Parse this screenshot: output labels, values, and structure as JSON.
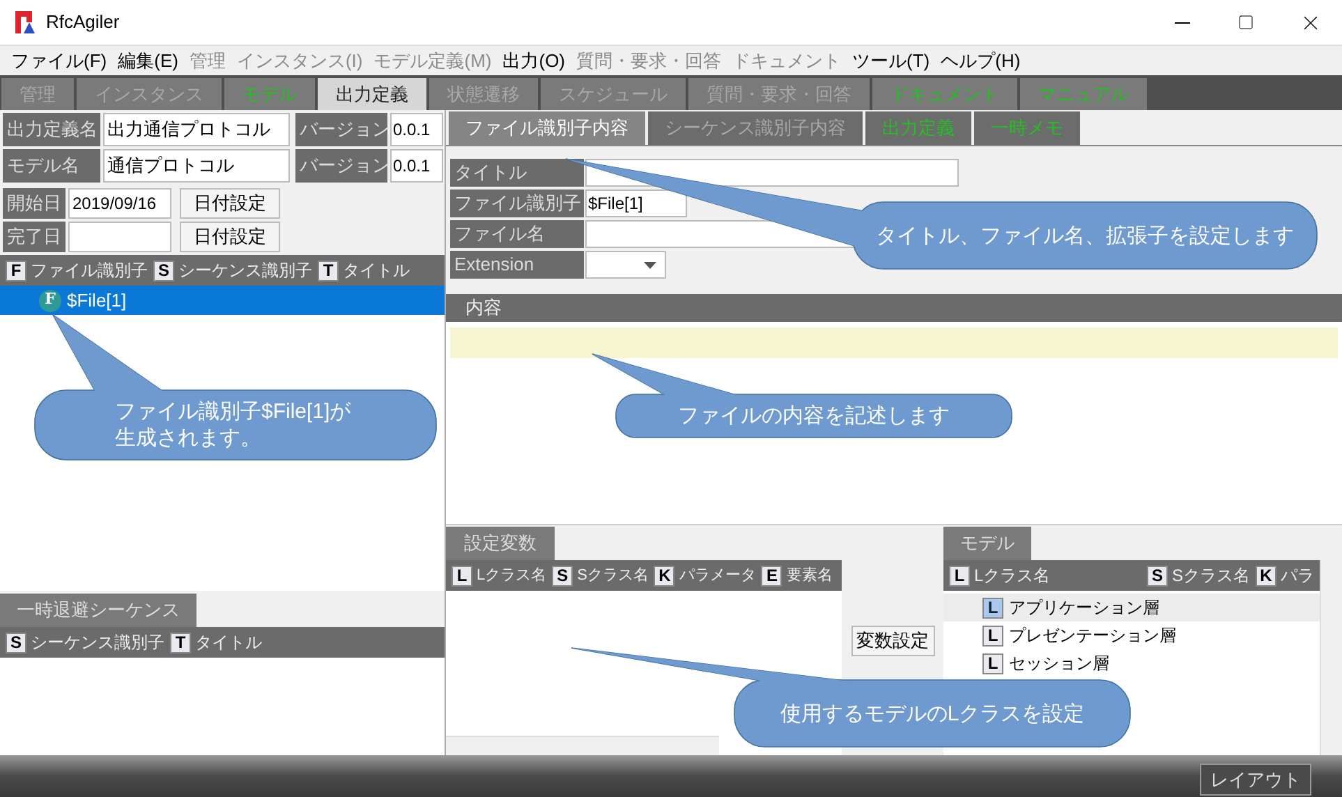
{
  "window": {
    "title": "RfcAgiler"
  },
  "menu": [
    {
      "label": "ファイル(F)",
      "disabled": false
    },
    {
      "label": "編集(E)",
      "disabled": false
    },
    {
      "label": "管理",
      "disabled": true
    },
    {
      "label": "インスタンス(I)",
      "disabled": true
    },
    {
      "label": "モデル定義(M)",
      "disabled": true
    },
    {
      "label": "出力(O)",
      "disabled": false
    },
    {
      "label": "質問・要求・回答",
      "disabled": true
    },
    {
      "label": "ドキュメント",
      "disabled": true
    },
    {
      "label": "ツール(T)",
      "disabled": false
    },
    {
      "label": "ヘルプ(H)",
      "disabled": false
    }
  ],
  "main_tabs": [
    {
      "label": "管理",
      "selected": false,
      "kind": "disabled"
    },
    {
      "label": "インスタンス",
      "selected": false,
      "kind": "disabled"
    },
    {
      "label": "モデル",
      "selected": false,
      "kind": "green"
    },
    {
      "label": "出力定義",
      "selected": true,
      "kind": "plain"
    },
    {
      "label": "状態遷移",
      "selected": false,
      "kind": "disabled"
    },
    {
      "label": "スケジュール",
      "selected": false,
      "kind": "disabled"
    },
    {
      "label": "質問・要求・回答",
      "selected": false,
      "kind": "disabled"
    },
    {
      "label": "ドキュメント",
      "selected": false,
      "kind": "green"
    },
    {
      "label": "マニュアル",
      "selected": false,
      "kind": "green"
    }
  ],
  "definition": {
    "rows": [
      {
        "label": "出力定義名",
        "value": "出力通信プロトコル",
        "version_label": "バージョン",
        "version": "0.0.1"
      },
      {
        "label": "モデル名",
        "value": "通信プロトコル",
        "version_label": "バージョン",
        "version": "0.0.1"
      }
    ],
    "dates": [
      {
        "label": "開始日",
        "value": "2019/09/16",
        "button": "日付設定"
      },
      {
        "label": "完了日",
        "button": "日付設定"
      }
    ]
  },
  "file_list": {
    "columns": [
      {
        "badge": "F",
        "label": "ファイル識別子"
      },
      {
        "badge": "S",
        "label": "シーケンス識別子"
      },
      {
        "badge": "T",
        "label": "タイトル"
      }
    ],
    "items": [
      {
        "badge": "F",
        "label": "$File[1]",
        "selected": true
      }
    ]
  },
  "temp_sequences": {
    "tab": "一時退避シーケンス",
    "columns": [
      {
        "badge": "S",
        "label": "シーケンス識別子"
      },
      {
        "badge": "T",
        "label": "タイトル"
      }
    ]
  },
  "content_tabs": [
    {
      "label": "ファイル識別子内容",
      "selected": true,
      "kind": "plain"
    },
    {
      "label": "シーケンス識別子内容",
      "selected": false,
      "kind": "disabled"
    },
    {
      "label": "出力定義",
      "selected": false,
      "kind": "green"
    },
    {
      "label": "一時メモ",
      "selected": false,
      "kind": "green"
    }
  ],
  "file_form": {
    "fields": [
      {
        "label": "タイトル",
        "kind": "long"
      },
      {
        "label": "ファイル識別子",
        "kind": "short",
        "value": "$File[1]"
      },
      {
        "label": "ファイル名",
        "kind": "medium"
      },
      {
        "label": "Extension",
        "kind": "select"
      }
    ]
  },
  "content": {
    "title": "内容"
  },
  "variables": {
    "tab": "設定変数",
    "columns": [
      {
        "badge": "L",
        "label": "Lクラス名"
      },
      {
        "badge": "S",
        "label": "Sクラス名"
      },
      {
        "badge": "K",
        "label": "パラメータ"
      },
      {
        "badge": "E",
        "label": "要素名"
      }
    ]
  },
  "set_button": "変数設定",
  "model": {
    "tab": "モデル",
    "columns": [
      {
        "badge": "L",
        "label": "Lクラス名"
      },
      {
        "badge": "S",
        "label": "Sクラス名"
      },
      {
        "badge": "K",
        "label": "パラ"
      }
    ],
    "rows": [
      {
        "badge": "L",
        "label": "アプリケーション層",
        "selected": true
      },
      {
        "badge": "L",
        "label": "プレゼンテーション層",
        "selected": false
      },
      {
        "badge": "L",
        "label": "セッション層",
        "selected": false
      }
    ]
  },
  "layout_button": "レイアウト",
  "callouts": [
    {
      "text": "ファイル識別子$File[1]が生成されます。"
    },
    {
      "text": "タイトル、ファイル名、拡張子を設定します"
    },
    {
      "text": "ファイルの内容を記述します"
    },
    {
      "text": "使用するモデルのLクラスを設定"
    }
  ]
}
